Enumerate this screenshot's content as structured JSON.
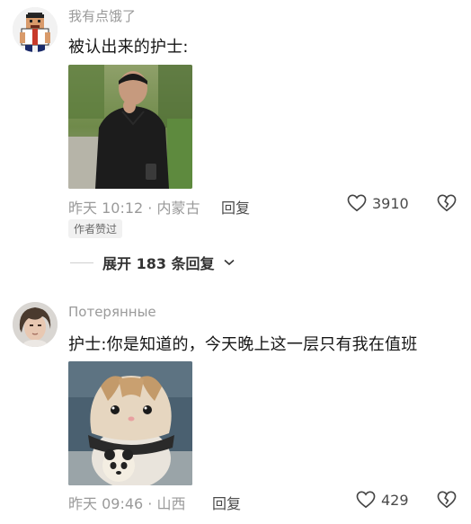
{
  "comments": [
    {
      "username": "我有点饿了",
      "text": "被认出来的护士:",
      "time_location": "昨天 10:12 · 内蒙古",
      "reply_label": "回复",
      "likes": "3910",
      "badge": "作者赞过",
      "expand_label": "展开 183 条回复"
    },
    {
      "username": "Потерянные",
      "text": "护士:你是知道的，今天晚上这一层只有我在值班",
      "time_location": "昨天 09:46 · 山西",
      "reply_label": "回复",
      "likes": "429"
    }
  ],
  "icons": {
    "like": "heart-outline-icon",
    "dislike": "broken-heart-icon",
    "expand": "chevron-down-icon"
  }
}
